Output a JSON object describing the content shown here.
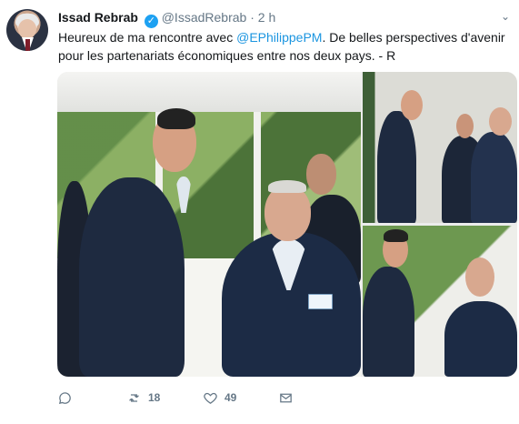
{
  "tweet": {
    "author_name": "Issad Rebrab",
    "verified": true,
    "handle": "@IssadRebrab",
    "separator": "·",
    "time": "2 h",
    "text_part1": "Heureux de ma rencontre avec ",
    "mention": "@EPhilippePM",
    "text_part2": ". De belles perspectives d'avenir pour les partenariats économiques entre nos deux pays. - R",
    "retweets": "18",
    "likes": "49"
  },
  "icons": {
    "verified": "verified-badge-icon",
    "more": "chevron-down-icon",
    "reply": "reply-icon",
    "retweet": "retweet-icon",
    "like": "heart-icon",
    "message": "message-icon"
  },
  "colors": {
    "link": "#1b95e0",
    "verified": "#1da1f2",
    "muted": "#657786"
  }
}
